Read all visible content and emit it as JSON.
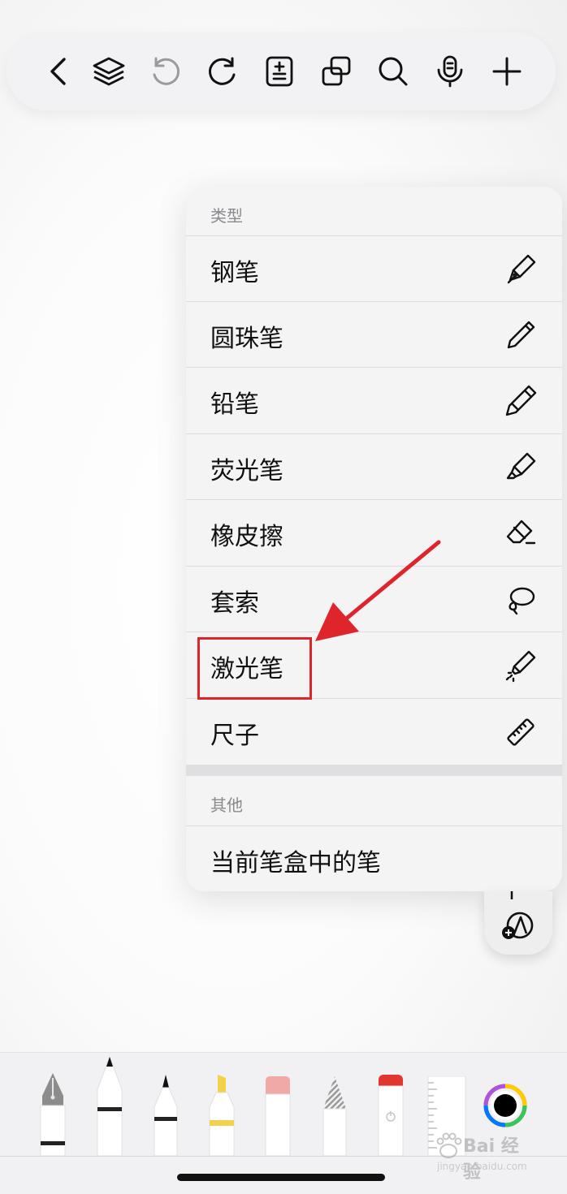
{
  "toolbar": {
    "icons": [
      "back-icon",
      "layers-icon",
      "undo-icon",
      "redo-icon",
      "insert-page-icon",
      "duplicate-icon",
      "search-icon",
      "microphone-icon",
      "add-icon"
    ]
  },
  "menu": {
    "section_types_header": "类型",
    "items": [
      {
        "label": "钢笔",
        "icon": "fountain-pen-icon"
      },
      {
        "label": "圆珠笔",
        "icon": "ballpoint-pen-icon"
      },
      {
        "label": "铅笔",
        "icon": "pencil-icon"
      },
      {
        "label": "荧光笔",
        "icon": "highlighter-icon"
      },
      {
        "label": "橡皮擦",
        "icon": "eraser-icon"
      },
      {
        "label": "套索",
        "icon": "lasso-icon"
      },
      {
        "label": "激光笔",
        "icon": "laser-pointer-icon"
      },
      {
        "label": "尺子",
        "icon": "ruler-icon"
      }
    ],
    "section_other_header": "其他",
    "other_item": "当前笔盒中的笔"
  },
  "annotation": {
    "color": "#e0242b",
    "highlighted_item": "激光笔"
  },
  "tray": {
    "tools": [
      "fountain-pen",
      "ballpoint-pen",
      "fine-pen",
      "highlighter",
      "eraser",
      "lasso",
      "laser-pointer",
      "ruler",
      "color-picker"
    ],
    "selected_color": "#000000"
  },
  "watermark": {
    "text": "Bai 经验",
    "url": "jingyan.baidu.com"
  }
}
